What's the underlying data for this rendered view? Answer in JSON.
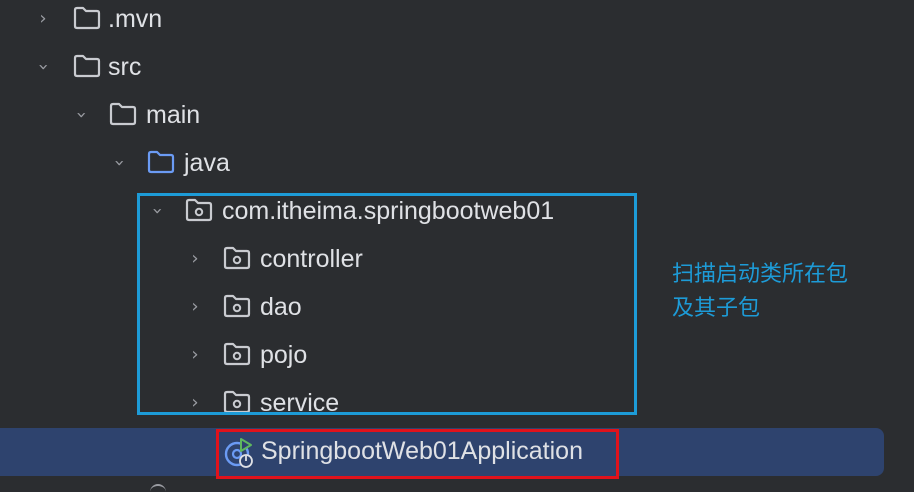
{
  "project_tree": {
    "items": [
      {
        "label": ".mvn",
        "expanded": false,
        "icon": "folder-icon"
      },
      {
        "label": "src",
        "expanded": true,
        "icon": "folder-icon"
      },
      {
        "label": "main",
        "expanded": true,
        "icon": "folder-icon"
      },
      {
        "label": "java",
        "expanded": true,
        "icon": "source-root-folder-icon"
      },
      {
        "label": "com.itheima.springbootweb01",
        "expanded": true,
        "icon": "package-icon"
      },
      {
        "label": "controller",
        "expanded": false,
        "icon": "package-icon"
      },
      {
        "label": "dao",
        "expanded": false,
        "icon": "package-icon"
      },
      {
        "label": "pojo",
        "expanded": false,
        "icon": "package-icon"
      },
      {
        "label": "service",
        "expanded": false,
        "icon": "package-icon"
      },
      {
        "label": "SpringbootWeb01Application",
        "selected": true,
        "icon": "spring-boot-application-class-icon"
      }
    ]
  },
  "annotation": {
    "line1": "扫描启动类所在包",
    "line2": "及其子包"
  },
  "colors": {
    "background": "#2b2d30",
    "selected_row": "#2e436e",
    "annotation_box": "#1d9bd7",
    "highlight_box": "#e0121b",
    "source_root_folder": "#6b9bf4"
  }
}
